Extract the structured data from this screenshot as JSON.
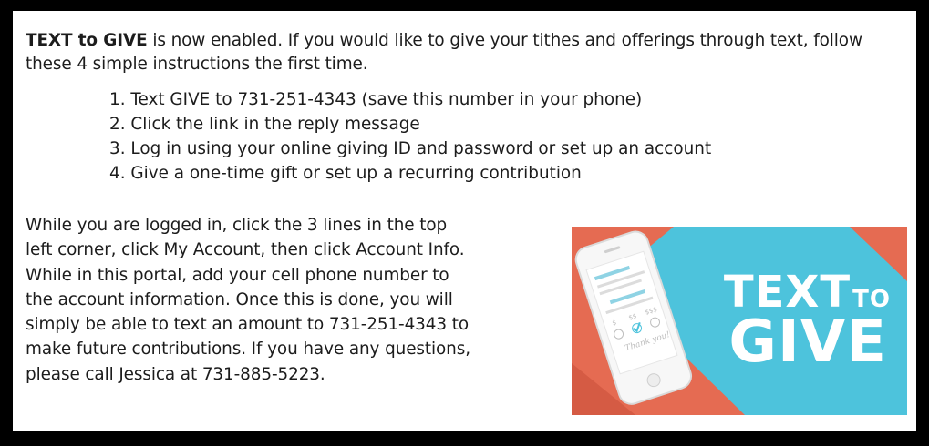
{
  "intro": {
    "highlight": "TEXT to GIVE",
    "rest": " is now enabled. If you would like to give your tithes and offerings through text, follow these 4 simple instructions the first time."
  },
  "steps": [
    "1. Text GIVE to 731-251-4343 (save this number in your phone)",
    "2. Click the link in the reply message",
    "3. Log in using your online giving ID and password or set up an account",
    "4. Give a one-time gift or set up a recurring contribution"
  ],
  "body_lines": [
    "While you are logged in, click the 3 lines in the top",
    "left corner, click My Account, then click Account Info.",
    "While in this portal, add your cell phone number to",
    "the account information. Once this is done, you will",
    "simply be able to text an amount to 731-251-4343 to",
    "make future contributions. If you have any questions,",
    "please call Jessica at 731-885-5223."
  ],
  "banner": {
    "line1_big": "TEXT",
    "line1_small": "TO",
    "line2": "GIVE",
    "phone_amounts": [
      "$",
      "$$",
      "$$$"
    ],
    "phone_caption": "Thank you!",
    "colors": {
      "coral": "#E56B52",
      "teal": "#4DC3DC",
      "white": "#FFFFFF"
    }
  }
}
